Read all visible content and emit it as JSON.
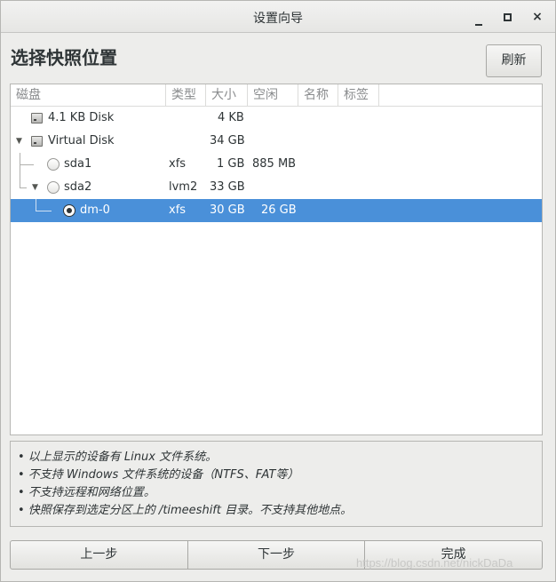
{
  "window": {
    "title": "设置向导",
    "controls": {
      "minimize": "minimize-icon",
      "maximize": "maximize-icon",
      "close": "×"
    }
  },
  "page": {
    "heading": "选择快照位置",
    "refresh_label": "刷新"
  },
  "tree": {
    "columns": [
      "磁盘",
      "类型",
      "大小",
      "空闲",
      "名称",
      "标签"
    ],
    "rows": [
      {
        "name": "4.1 KB Disk",
        "type": "",
        "size": "4 KB",
        "free": "",
        "icon": "disk-icon",
        "expander": ""
      },
      {
        "name": "Virtual Disk",
        "type": "",
        "size": "34 GB",
        "free": "",
        "icon": "disk-icon",
        "expander": "▼"
      },
      {
        "name": "sda1",
        "type": "xfs",
        "size": "1 GB",
        "free": "885 MB",
        "icon": "radio",
        "expander": ""
      },
      {
        "name": "sda2",
        "type": "lvm2",
        "size": "33 GB",
        "free": "",
        "icon": "radio",
        "expander": "▼"
      },
      {
        "name": "dm-0",
        "type": "xfs",
        "size": "30 GB",
        "free": "26 GB",
        "icon": "radio-checked",
        "expander": "",
        "selected": true
      }
    ],
    "colors": {
      "selected_row": "#4a90d9"
    }
  },
  "info": {
    "lines": [
      "• 以上显示的设备有 Linux 文件系统。",
      "• 不支持 Windows 文件系统的设备（NTFS、FAT等）",
      "• 不支持远程和网络位置。",
      "• 快照保存到选定分区上的 /timeeshift 目录。不支持其他地点。"
    ]
  },
  "buttons": {
    "prev": "上一步",
    "next": "下一步",
    "finish": "完成"
  },
  "watermark": "https://blog.csdn.net/nickDaDa"
}
